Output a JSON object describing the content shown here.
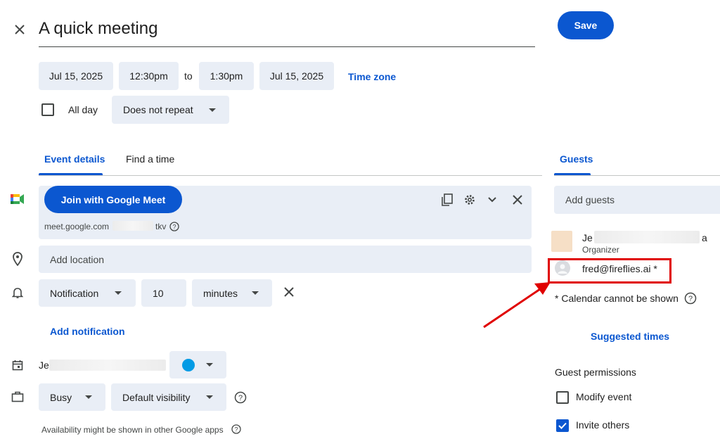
{
  "header": {
    "title": "A quick meeting",
    "save_label": "Save"
  },
  "datetime": {
    "start_date": "Jul 15, 2025",
    "start_time": "12:30pm",
    "to_label": "to",
    "end_time": "1:30pm",
    "end_date": "Jul 15, 2025",
    "timezone_label": "Time zone",
    "all_day_label": "All day",
    "repeat_value": "Does not repeat"
  },
  "tabs": {
    "details": "Event details",
    "find_time": "Find a time",
    "guests": "Guests"
  },
  "meet": {
    "join_label": "Join with Google Meet",
    "link_prefix": "meet.google.com",
    "link_suffix": "tkv"
  },
  "location": {
    "placeholder": "Add location"
  },
  "notification": {
    "type": "Notification",
    "amount": "10",
    "unit": "minutes",
    "add_label": "Add notification"
  },
  "calendar": {
    "owner_prefix": "Je",
    "color": "#039be5"
  },
  "status": {
    "busy": "Busy",
    "visibility": "Default visibility",
    "note": "Availability might be shown in other Google apps"
  },
  "guests": {
    "add_placeholder": "Add guests",
    "organizer": {
      "name_prefix": "Je",
      "name_suffix": "a",
      "role": "Organizer"
    },
    "guest": {
      "email": "fred@fireflies.ai *"
    },
    "calendar_note": "* Calendar cannot be shown",
    "suggested_times": "Suggested times",
    "permissions_title": "Guest permissions",
    "modify_event": "Modify event",
    "invite_others": "Invite others"
  },
  "colors": {
    "accent": "#0b57d0",
    "highlight": "#e00000"
  }
}
